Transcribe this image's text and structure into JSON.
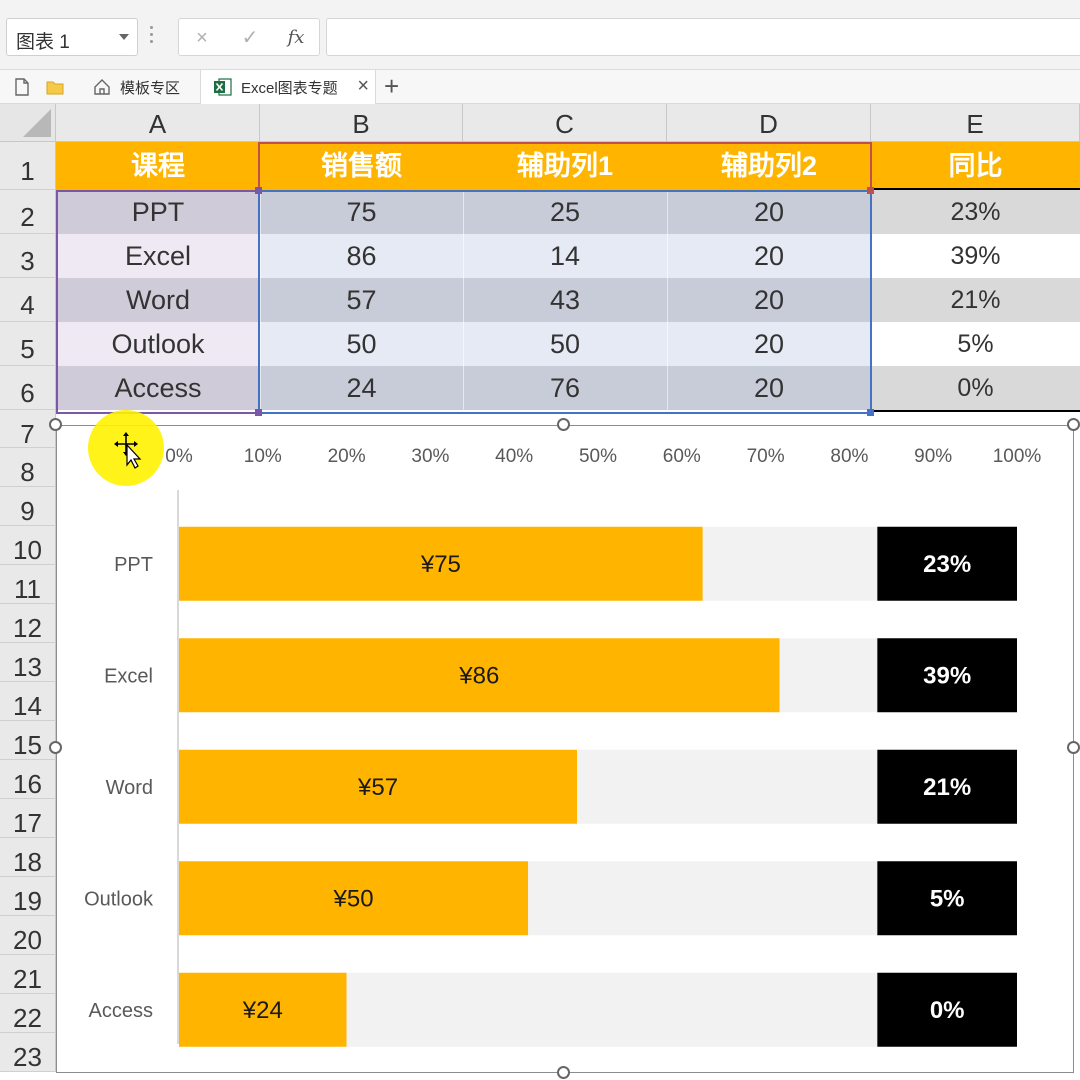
{
  "formula_bar": {
    "name_box": "图表 1",
    "cancel_icon": "×",
    "enter_icon": "✓",
    "fx_icon": "fx"
  },
  "tabs": {
    "templates_label": "模板专区",
    "active_label": "Excel图表专题",
    "close_icon": "×",
    "add_icon": "+"
  },
  "columns": [
    "A",
    "B",
    "C",
    "D",
    "E"
  ],
  "rows": [
    "1",
    "2",
    "3",
    "4",
    "5",
    "6",
    "7",
    "8",
    "9",
    "10",
    "11",
    "12",
    "13",
    "14",
    "15",
    "16",
    "17",
    "18",
    "19",
    "20",
    "21",
    "22",
    "23"
  ],
  "table": {
    "headers": [
      "课程",
      "销售额",
      "辅助列1",
      "辅助列2",
      "同比"
    ],
    "rows": [
      [
        "PPT",
        "75",
        "25",
        "20",
        "23%"
      ],
      [
        "Excel",
        "86",
        "14",
        "20",
        "39%"
      ],
      [
        "Word",
        "57",
        "43",
        "20",
        "21%"
      ],
      [
        "Outlook",
        "50",
        "50",
        "20",
        "5%"
      ],
      [
        "Access",
        "24",
        "76",
        "20",
        "0%"
      ]
    ]
  },
  "chart_data": {
    "type": "bar",
    "orientation": "horizontal",
    "stacked": true,
    "percent_stacked": true,
    "categories": [
      "PPT",
      "Excel",
      "Word",
      "Outlook",
      "Access"
    ],
    "series": [
      {
        "values": [
          75,
          86,
          57,
          50,
          24
        ],
        "color": "#ffb400",
        "data_labels": [
          "¥75",
          "¥86",
          "¥57",
          "¥50",
          "¥24"
        ]
      },
      {
        "values": [
          25,
          14,
          43,
          50,
          76
        ],
        "color": "#f2f2f2"
      },
      {
        "values": [
          20,
          20,
          20,
          20,
          20
        ],
        "color": "#000000",
        "data_labels": [
          "23%",
          "39%",
          "21%",
          "5%",
          "0%"
        ]
      }
    ],
    "x_ticks": [
      "0%",
      "10%",
      "20%",
      "30%",
      "40%",
      "50%",
      "60%",
      "70%",
      "80%",
      "90%",
      "100%"
    ],
    "xlim": [
      0,
      100
    ],
    "x_axis_position": "top",
    "grid": false,
    "legend": "none"
  },
  "colors": {
    "header_fill": "#ffb400",
    "band_dark": "#c8ccd8",
    "band_light": "#e6eaf5",
    "selection_blue": "#4472c4",
    "selection_purple": "#7b57a8"
  }
}
